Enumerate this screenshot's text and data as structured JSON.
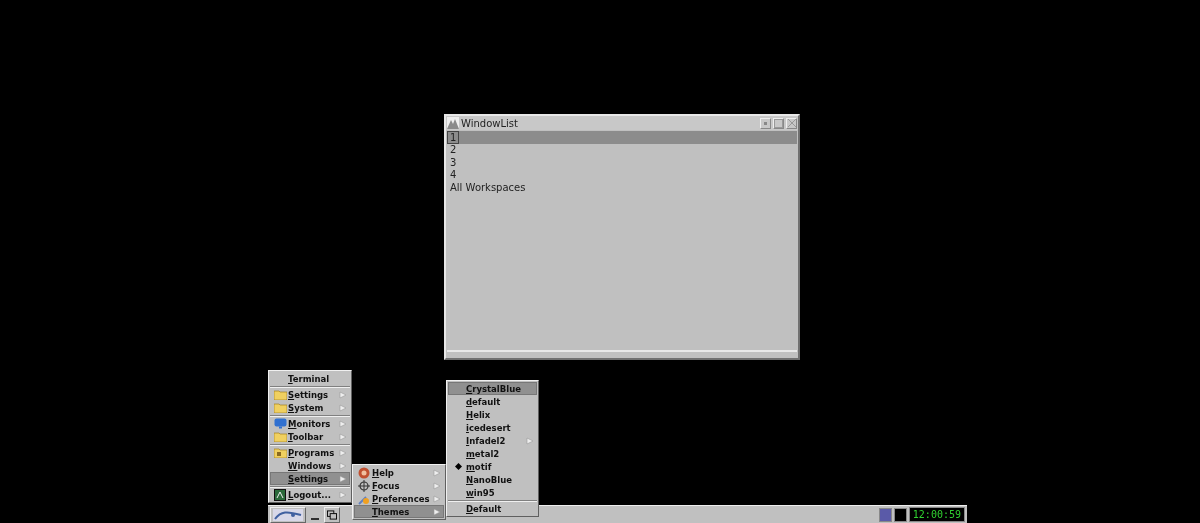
{
  "window": {
    "title": "WindowList",
    "items": [
      {
        "label": "1",
        "selected": true
      },
      {
        "label": "2",
        "selected": false
      },
      {
        "label": "3",
        "selected": false
      },
      {
        "label": "4",
        "selected": false
      },
      {
        "label": "All Workspaces",
        "selected": false
      }
    ]
  },
  "start_menu": {
    "groups": [
      [
        {
          "label": "Terminal",
          "kind": "plain",
          "submenu": false,
          "selected": false
        }
      ],
      [
        {
          "label": "Settings",
          "kind": "folder",
          "submenu": true,
          "selected": false
        },
        {
          "label": "System",
          "kind": "folder",
          "submenu": true,
          "selected": false
        }
      ],
      [
        {
          "label": "Monitors",
          "kind": "monitor",
          "submenu": true,
          "selected": false
        },
        {
          "label": "Toolbar",
          "kind": "folder",
          "submenu": true,
          "selected": false
        }
      ],
      [
        {
          "label": "Programs",
          "kind": "apps",
          "submenu": true,
          "selected": false
        },
        {
          "label": "Windows",
          "kind": "plain",
          "submenu": true,
          "selected": false
        },
        {
          "label": "Settings",
          "kind": "plain",
          "submenu": true,
          "selected": true
        }
      ],
      [
        {
          "label": "Logout...",
          "kind": "logout",
          "submenu": true,
          "selected": false
        }
      ]
    ]
  },
  "settings_menu": {
    "groups": [
      [
        {
          "label": "Help",
          "kind": "help",
          "submenu": true,
          "selected": false
        },
        {
          "label": "Focus",
          "kind": "focus",
          "submenu": true,
          "selected": false
        },
        {
          "label": "Preferences",
          "kind": "prefs",
          "submenu": true,
          "selected": false
        },
        {
          "label": "Themes",
          "kind": "plain",
          "submenu": true,
          "selected": true
        }
      ]
    ]
  },
  "themes_menu": {
    "groups": [
      [
        {
          "label": "CrystalBlue",
          "checked": false,
          "submenu": false,
          "selected": true
        },
        {
          "label": "default",
          "checked": false,
          "submenu": false,
          "selected": false
        },
        {
          "label": "Helix",
          "checked": false,
          "submenu": false,
          "selected": false
        },
        {
          "label": "icedesert",
          "checked": false,
          "submenu": false,
          "selected": false
        },
        {
          "label": "Infadel2",
          "checked": false,
          "submenu": true,
          "selected": false
        },
        {
          "label": "metal2",
          "checked": false,
          "submenu": false,
          "selected": false
        },
        {
          "label": "motif",
          "checked": true,
          "submenu": false,
          "selected": false
        },
        {
          "label": "NanoBlue",
          "checked": false,
          "submenu": false,
          "selected": false
        },
        {
          "label": "win95",
          "checked": false,
          "submenu": false,
          "selected": false
        }
      ],
      [
        {
          "label": "Default",
          "checked": false,
          "submenu": false,
          "selected": false
        }
      ]
    ]
  },
  "taskbar": {
    "workspaces": [
      {
        "selected": true
      },
      {
        "selected": false
      }
    ],
    "clock": "12:00:59"
  }
}
